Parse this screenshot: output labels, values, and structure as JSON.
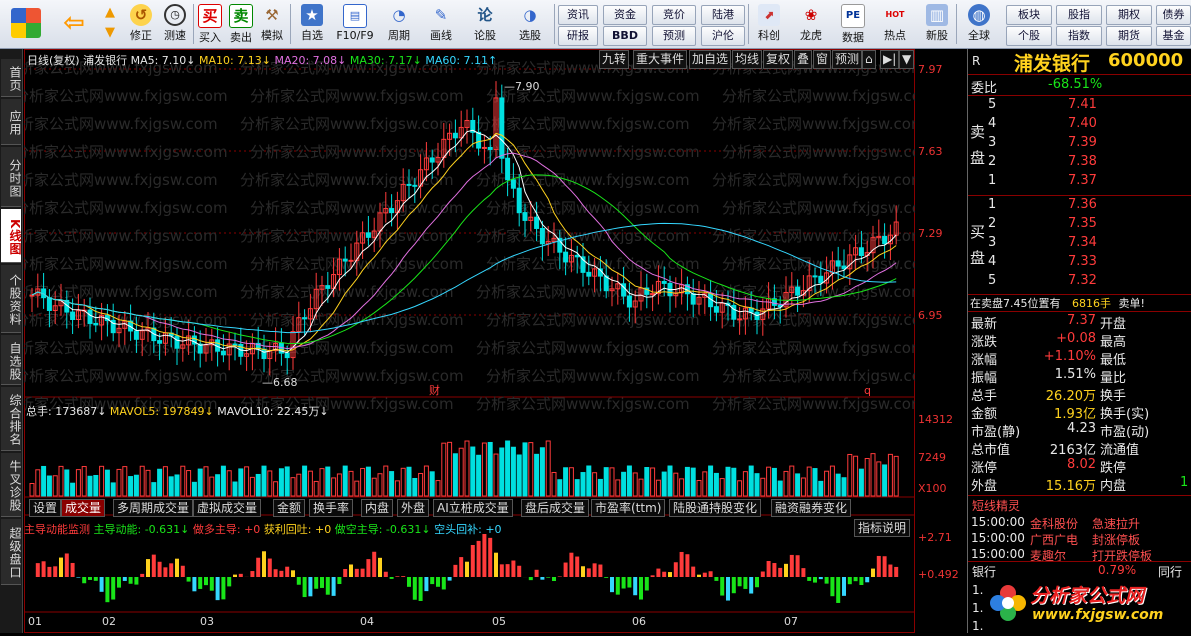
{
  "toolbar": {
    "buttons": [
      {
        "label": "",
        "icon": "grid-icon"
      },
      {
        "label": "",
        "icon": "back-arrow-icon"
      },
      {
        "label": "",
        "icon": "up-down-arrows-icon"
      },
      {
        "label": "修正",
        "icon": "revise-icon"
      },
      {
        "label": "测速",
        "icon": "clock-icon"
      },
      {
        "label": "买入",
        "icon": "buy-icon",
        "glyph": "买"
      },
      {
        "label": "卖出",
        "icon": "sell-icon",
        "glyph": "卖"
      },
      {
        "label": "模拟",
        "icon": "hammer-icon"
      },
      {
        "label": "自选",
        "icon": "star-icon"
      },
      {
        "label": "F10/F9",
        "icon": "f10-icon"
      },
      {
        "label": "周期",
        "icon": "period-icon"
      },
      {
        "label": "画线",
        "icon": "pencil-icon"
      },
      {
        "label": "论股",
        "icon": "discuss-icon",
        "glyph": "论"
      },
      {
        "label": "选股",
        "icon": "select-icon"
      },
      {
        "label": "科创",
        "icon": "kechuang-icon"
      },
      {
        "label": "龙虎",
        "icon": "dragon-tiger-icon"
      },
      {
        "label": "数据",
        "icon": "data-icon",
        "glyph": "PE"
      },
      {
        "label": "热点",
        "icon": "hot-icon",
        "glyph": "HOT"
      },
      {
        "label": "新股",
        "icon": "ipo-icon"
      },
      {
        "label": "全球",
        "icon": "globe-icon"
      }
    ],
    "pills_mid": [
      "资讯",
      "资金",
      "竞价",
      "陆港",
      "研报",
      "BBD",
      "预测",
      "沪伦"
    ],
    "pills_right": [
      "板块",
      "股指",
      "期权",
      "债券",
      "个股",
      "指数",
      "期货",
      "基金"
    ]
  },
  "left_tabs": [
    "首页",
    "应用",
    "分时图",
    "K线图",
    "个股资料",
    "自选股",
    "综合排名",
    "牛叉诊股",
    "超级盘口"
  ],
  "header": {
    "period": "日线(复权)",
    "stock": "浦发银行",
    "ma5": "MA5: 7.10↓",
    "ma10": "MA10: 7.13↓",
    "ma20": "MA20: 7.08↓",
    "ma30": "MA30: 7.17↓",
    "ma60": "MA60: 7.11↑",
    "menus": [
      "九转",
      "重大事件",
      "加自选",
      "均线",
      "复权",
      "叠",
      "窗",
      "预测",
      "⌂",
      "▶|",
      "▼"
    ]
  },
  "watermark": "分析家公式网www.fxjgsw.com",
  "price_scale": [
    "7.97",
    "7.63",
    "7.29",
    "6.95"
  ],
  "markers": {
    "high": "7.90",
    "low": "6.68",
    "cai": "财",
    "q": "q"
  },
  "volume": {
    "line": "总手: 173687↓",
    "mavol5": "MAVOL5: 197849↓",
    "mavol10": "MAVOL10: 22.45万↓",
    "scale": [
      "14312",
      "7249",
      "X100"
    ]
  },
  "subtabs": [
    "设置",
    "成交量",
    "多周期成交量",
    "虚拟成交量",
    "金额",
    "换手率",
    "内盘",
    "外盘",
    "AI立桩成交量",
    "盘后成交量",
    "市盈率(ttm)",
    "陆股通持股变化",
    "融资融券变化"
  ],
  "indicator": {
    "title": "主导动能监测",
    "main": "主导动能: -0.631↓",
    "duo": "做多主导: +0",
    "huotou": "获利回吐: +0",
    "kong": "做空主导: -0.631↓",
    "buy": "空头回补: +0",
    "help": "指标说明",
    "scale": [
      "+2.71",
      "+0.492"
    ]
  },
  "months": [
    "01",
    "02",
    "03",
    "04",
    "05",
    "06",
    "07"
  ],
  "panel": {
    "r": "R",
    "name": "浦发银行",
    "code": "600000",
    "weibi_label": "委比",
    "weibi": "-68.51%",
    "sell_label": "卖盘",
    "buy_label": "买盘",
    "sell": [
      [
        "5",
        "7.41"
      ],
      [
        "4",
        "7.40"
      ],
      [
        "3",
        "7.39"
      ],
      [
        "2",
        "7.38"
      ],
      [
        "1",
        "7.37"
      ]
    ],
    "buy": [
      [
        "1",
        "7.36"
      ],
      [
        "2",
        "7.35"
      ],
      [
        "3",
        "7.34"
      ],
      [
        "4",
        "7.33"
      ],
      [
        "5",
        "7.32"
      ]
    ],
    "notice_a": "在卖盘7.45位置有",
    "notice_b": "6816手",
    "notice_c": "卖单!",
    "stats": [
      [
        "最新",
        "7.37",
        "开盘",
        ""
      ],
      [
        "涨跌",
        "+0.08",
        "最高",
        ""
      ],
      [
        "涨幅",
        "+1.10%",
        "最低",
        ""
      ],
      [
        "振幅",
        "1.51%",
        "量比",
        ""
      ],
      [
        "总手",
        "26.20万",
        "换手",
        ""
      ],
      [
        "金额",
        "1.93亿",
        "换手(实)",
        ""
      ],
      [
        "市盈(静)",
        "4.23",
        "市盈(动)",
        ""
      ],
      [
        "总市值",
        "2163亿",
        "流通值",
        ""
      ],
      [
        "涨停",
        "8.02",
        "跌停",
        ""
      ],
      [
        "外盘",
        "15.16万",
        "内盘",
        "1"
      ]
    ],
    "jingling_title": "短线精灵",
    "jingling": [
      [
        "15:00:00",
        "金科股份",
        "急速拉升"
      ],
      [
        "15:00:00",
        "广西广电",
        "封涨停板"
      ],
      [
        "15:00:00",
        "麦趣尔",
        "打开跌停板"
      ]
    ],
    "bottom_a": "银行",
    "bottom_b": "0.79%",
    "bottom_c": "同行",
    "logo_text": "分析家公式网",
    "logo_url": "www.fxjgsw.com"
  },
  "colors": {
    "up": "#ff3b3b",
    "down": "#00e0e0",
    "bg": "#000000",
    "grid": "#8a0000"
  }
}
